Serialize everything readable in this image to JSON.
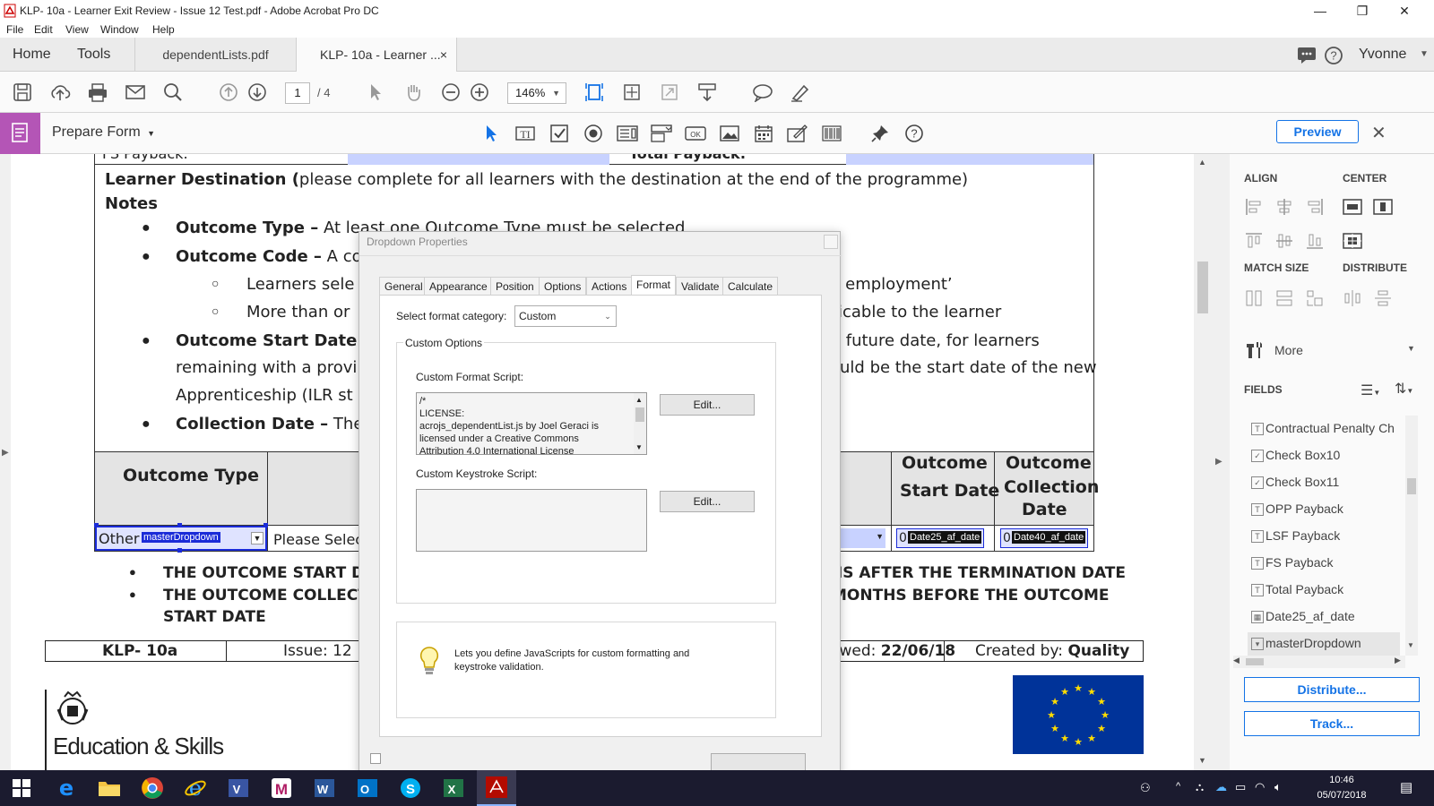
{
  "window": {
    "title": "KLP- 10a - Learner Exit Review - Issue 12 Test.pdf - Adobe Acrobat Pro DC"
  },
  "menu": [
    "File",
    "Edit",
    "View",
    "Window",
    "Help"
  ],
  "tabs": {
    "home": "Home",
    "tools": "Tools",
    "doc1": "dependentLists.pdf",
    "doc2": "KLP- 10a - Learner ...",
    "close": "×"
  },
  "user": {
    "name": "Yvonne"
  },
  "toolbar": {
    "page_current": "1",
    "page_total": "/ 4",
    "zoom": "146%"
  },
  "prepare": {
    "label": "Prepare Form",
    "preview": "Preview"
  },
  "doc": {
    "top_label": "FS Payback:",
    "top_label2": "Total Payback:",
    "dest_title": "Learner Destination (",
    "dest_rest": "please complete for all learners with the destination at the end of the programme)",
    "notes": "Notes",
    "b1_bold": "Outcome Type –",
    "b1_rest": " At least one Outcome Type must be selected",
    "b2_bold": "Outcome Code –",
    "b2_rest": " A co",
    "s1": "Learners sele",
    "s1r": "d employment’",
    "s2": "More than or",
    "s2r": "licable to the learner",
    "b3_bold": "Outcome Start Date -",
    "b3_r": "a future date, for learners",
    "b3_l2": "remaining with a provi",
    "b3_l2r": "ould be the start date of the new",
    "b3_l3": "Apprenticeship (ILR st",
    "b4_bold": "Collection Date –",
    "b4_rest": " The",
    "col_outcome_type": "Outcome Type",
    "col_start_l1": "Outcome",
    "col_start_l2": "Start Date",
    "col_coll_l1": "Outcome",
    "col_coll_l2": "Collection",
    "col_coll_l3": "Date",
    "field_other": "Other",
    "field_master": "masterDropdown",
    "field_please": "Please Selec",
    "field_date25": "Date25_af_date",
    "field_date40": "Date40_af_date",
    "field_zero": "0",
    "warn1": "THE OUTCOME START DAT",
    "warn1r": "HS AFTER THE TERMINATION DATE",
    "warn2": "THE OUTCOME COLLECTIO",
    "warn2r": "MONTHS BEFORE THE OUTCOME",
    "warn2b": "START DATE",
    "footer_klp": "KLP- 10a",
    "footer_issue": "Issue: 12",
    "footer_rev_label": "ewed: ",
    "footer_rev_date": "22/06/18",
    "footer_created_label": "Created by: ",
    "footer_created_val": "Quality",
    "logo_text": "Education & Skills"
  },
  "rpanel": {
    "align": "ALIGN",
    "center": "CENTER",
    "match": "MATCH SIZE",
    "distribute": "DISTRIBUTE",
    "more": "More",
    "fields": "FIELDS",
    "field_items": [
      "Contractual Penalty Ch",
      "Check Box10",
      "Check Box11",
      "OPP Payback",
      "LSF Payback",
      "FS Payback",
      "Total Payback",
      "Date25_af_date",
      "masterDropdown"
    ],
    "distribute_btn": "Distribute...",
    "track_btn": "Track..."
  },
  "dialog": {
    "title": "Dropdown Properties",
    "tabs": [
      "General",
      "Appearance",
      "Position",
      "Options",
      "Actions",
      "Format",
      "Validate",
      "Calculate"
    ],
    "category_label": "Select format category:",
    "category_value": "Custom",
    "custom_options": "Custom Options",
    "format_script_label": "Custom Format Script:",
    "script_lines": [
      "/*",
      "LICENSE:",
      "acrojs_dependentList.js by Joel Geraci is",
      "licensed under a Creative Commons",
      "Attribution 4.0 International License"
    ],
    "edit1": "Edit...",
    "keystroke_label": "Custom Keystroke Script:",
    "edit2": "Edit...",
    "hint": "Lets you define JavaScripts for custom formatting and keystroke validation."
  },
  "taskbar": {
    "time": "10:46",
    "date": "05/07/2018"
  }
}
